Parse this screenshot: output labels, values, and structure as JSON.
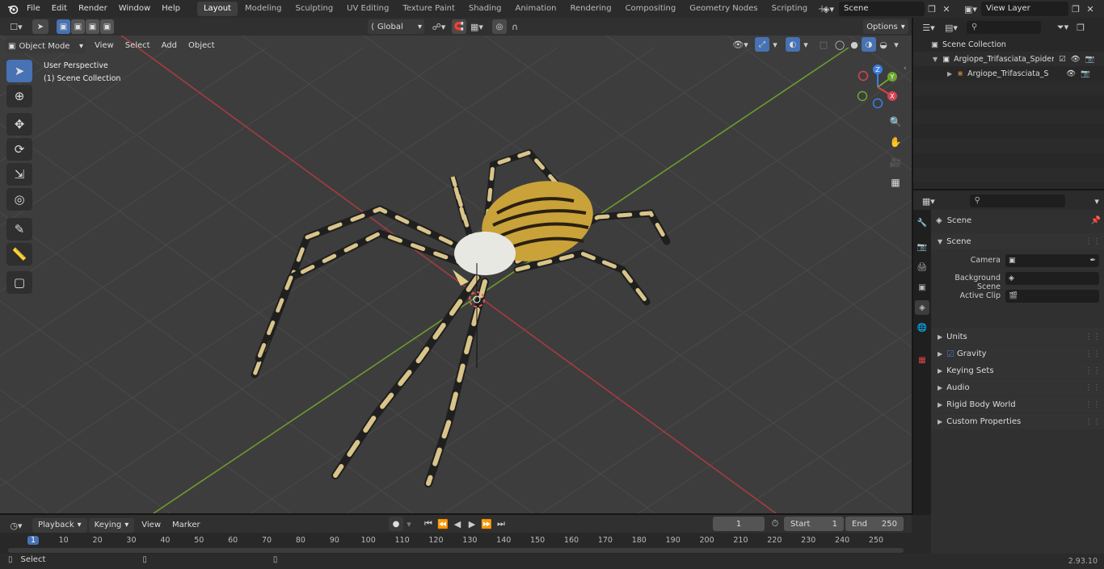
{
  "topbar": {
    "menus": [
      "File",
      "Edit",
      "Render",
      "Window",
      "Help"
    ],
    "workspaces": [
      "Layout",
      "Modeling",
      "Sculpting",
      "UV Editing",
      "Texture Paint",
      "Shading",
      "Animation",
      "Rendering",
      "Compositing",
      "Geometry Nodes",
      "Scripting"
    ],
    "add_tab": "+",
    "scene_name": "Scene",
    "view_layer": "View Layer"
  },
  "viewport": {
    "transform_orientation": "Global",
    "options_label": "Options",
    "mode": "Object Mode",
    "menus": [
      "View",
      "Select",
      "Add",
      "Object"
    ],
    "overlay_line1": "User Perspective",
    "overlay_line2": "(1) Scene Collection",
    "gizmo": {
      "z": "Z",
      "y": "Y",
      "x": "X"
    }
  },
  "outliner": {
    "search_placeholder": "",
    "root": "Scene Collection",
    "items": [
      {
        "label": "Argiope_Trifasciata_Spider"
      },
      {
        "label": "Argiope_Trifasciata_Spider"
      }
    ]
  },
  "properties": {
    "context_title": "Scene",
    "scene_panel": "Scene",
    "fields": [
      {
        "label": "Camera",
        "value": ""
      },
      {
        "label": "Background Scene",
        "value": ""
      },
      {
        "label": "Active Clip",
        "value": ""
      }
    ],
    "panels": [
      "Units",
      "Gravity",
      "Keying Sets",
      "Audio",
      "Rigid Body World",
      "Custom Properties"
    ]
  },
  "timeline": {
    "menus": [
      "Playback",
      "Keying",
      "View",
      "Marker"
    ],
    "current_frame": "1",
    "start_label": "Start",
    "start_value": "1",
    "end_label": "End",
    "end_value": "250",
    "ticks": [
      "1",
      "10",
      "20",
      "30",
      "40",
      "50",
      "60",
      "70",
      "80",
      "90",
      "100",
      "110",
      "120",
      "130",
      "140",
      "150",
      "160",
      "170",
      "180",
      "190",
      "200",
      "210",
      "220",
      "230",
      "240",
      "250"
    ]
  },
  "statusbar": {
    "left": "Select",
    "version": "2.93.10"
  },
  "colors": {
    "accent": "#4772b3",
    "x_axis": "#a83a43",
    "y_axis": "#6e9a2f",
    "viewport_bg": "#3d3d3d"
  }
}
